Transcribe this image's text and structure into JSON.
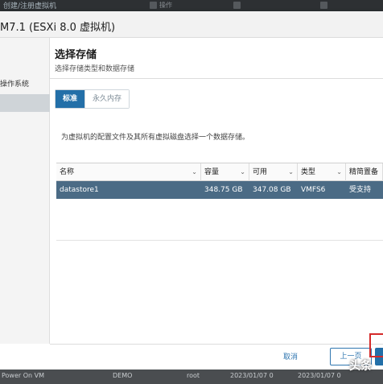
{
  "toolbar": {
    "title": "创建/注册虚拟机",
    "items": [
      "操作",
      "",
      ""
    ]
  },
  "dialog": {
    "title": "M7.1 (ESXi 8.0 虚拟机)",
    "steps": [
      "操作系统",
      ""
    ],
    "heading": "选择存储",
    "subheading": "选择存储类型和数据存储",
    "tabs": [
      "标准",
      "永久内存"
    ],
    "description": "为虚拟机的配置文件及其所有虚拟磁盘选择一个数据存储。",
    "table": {
      "columns": [
        "名称",
        "容量",
        "可用",
        "类型",
        "精简置备"
      ],
      "rows": [
        [
          "datastore1",
          "348.75 GB",
          "347.08 GB",
          "VMFS6",
          "受支持"
        ]
      ]
    },
    "buttons": {
      "cancel": "取消",
      "back": "上一页"
    }
  },
  "background_list": {
    "row": [
      "Power On VM",
      "DEMO",
      "root",
      "2023/01/07 0",
      "2023/01/07 0"
    ]
  },
  "watermark": "头条",
  "colors": {
    "accent": "#236fa8",
    "selected_row": "#4b6b85",
    "highlight": "#d42a2a"
  }
}
